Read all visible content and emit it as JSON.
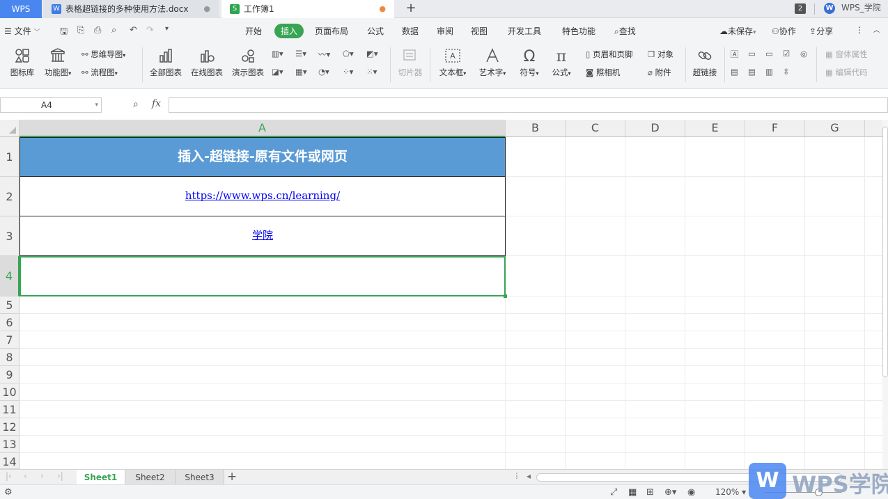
{
  "tabs": {
    "wps": "WPS",
    "doc": {
      "icon": "W",
      "title": "表格超链接的多种使用方法.docx",
      "close": "●"
    },
    "xls": {
      "icon": "S",
      "title": "工作簿1",
      "close": "●"
    },
    "new": "+"
  },
  "titlebar_right": {
    "badge": "2",
    "user": "WPS_学院"
  },
  "menu": {
    "file": "文件",
    "tabs": [
      "开始",
      "插入",
      "页面布局",
      "公式",
      "数据",
      "审阅",
      "视图",
      "开发工具",
      "特色功能",
      "查找"
    ],
    "right": {
      "unsaved": "未保存",
      "collab": "协作",
      "share": "分享"
    }
  },
  "ribbon": {
    "icon_lib": "图标库",
    "func_chart": "功能图",
    "mind_map": "思维导图",
    "flowchart": "流程图",
    "all_charts": "全部图表",
    "online_charts": "在线图表",
    "demo_chart": "演示图表",
    "slicer": "切片器",
    "textbox": "文本框",
    "wordart": "艺术字",
    "symbol": "符号",
    "formula": "公式",
    "header_footer": "页眉和页脚",
    "object": "对象",
    "camera": "照相机",
    "attachment": "附件",
    "hyperlink": "超链接",
    "form_props": "窗体属性",
    "edit_code": "编辑代码"
  },
  "formula_bar": {
    "name_box": "A4",
    "fx": "fx",
    "value": ""
  },
  "grid": {
    "columns": [
      "A",
      "B",
      "C",
      "D",
      "E",
      "F",
      "G"
    ],
    "rows": [
      "1",
      "2",
      "3",
      "4",
      "5",
      "6",
      "7",
      "8",
      "9",
      "10",
      "11",
      "12",
      "13",
      "14"
    ],
    "selected_cell": "A4",
    "cells": {
      "A1": "插入-超链接-原有文件或网页",
      "A2": "https://www.wps.cn/learning/",
      "A3": "学院"
    },
    "header_fill": "#5b9bd5",
    "selection_color": "#38a454"
  },
  "sheets": [
    "Sheet1",
    "Sheet2",
    "Sheet3"
  ],
  "status": {
    "zoom": "120%"
  },
  "watermark": {
    "logo": "W",
    "text": "WPS学院"
  }
}
